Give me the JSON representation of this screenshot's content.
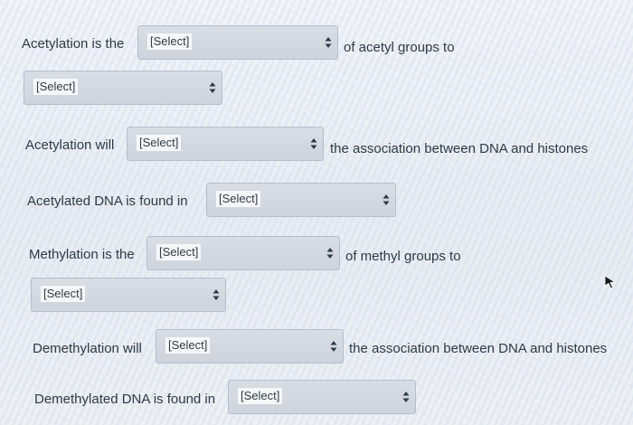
{
  "select_placeholder": "[Select]",
  "questions": [
    {
      "before": "Acetylation is the",
      "after": "of acetyl groups to"
    },
    {
      "before": "",
      "after": ""
    },
    {
      "before": "Acetylation will",
      "after": "the association between DNA and histones"
    },
    {
      "before": "Acetylated DNA is found in",
      "after": ""
    },
    {
      "before": "Methylation is the",
      "after": "of methyl groups to"
    },
    {
      "before": "",
      "after": ""
    },
    {
      "before": "Demethylation will",
      "after": "the association between DNA and histones"
    },
    {
      "before": "Demethylated DNA is found in",
      "after": ""
    }
  ]
}
